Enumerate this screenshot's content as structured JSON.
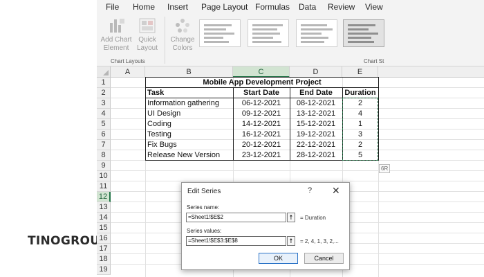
{
  "brand": {
    "name_left": "TINO",
    "name_right": "GROUP"
  },
  "menu": [
    "File",
    "Home",
    "Insert",
    "Page Layout",
    "Formulas",
    "Data",
    "Review",
    "View"
  ],
  "ribbon": {
    "add_chart_element": "Add Chart\nElement",
    "quick_layout": "Quick\nLayout",
    "change_colors": "Change\nColors",
    "group_chart_layouts": "Chart Layouts",
    "group_chart_styles": "Chart St"
  },
  "columns": [
    "A",
    "B",
    "C",
    "D",
    "E"
  ],
  "rows": [
    "1",
    "2",
    "3",
    "4",
    "5",
    "6",
    "7",
    "8",
    "9",
    "10",
    "11",
    "12",
    "13",
    "14",
    "15",
    "16",
    "17",
    "18",
    "19"
  ],
  "sheet": {
    "title": "Mobile App Development Project",
    "headers": [
      "Task",
      "Start Date",
      "End Date",
      "Duration"
    ],
    "tasks": [
      {
        "task": "Information gathering",
        "start": "06-12-2021",
        "end": "08-12-2021",
        "duration": "2"
      },
      {
        "task": "UI Design",
        "start": "09-12-2021",
        "end": "13-12-2021",
        "duration": "4"
      },
      {
        "task": "Coding",
        "start": "14-12-2021",
        "end": "15-12-2021",
        "duration": "1"
      },
      {
        "task": "Testing",
        "start": "16-12-2021",
        "end": "19-12-2021",
        "duration": "3"
      },
      {
        "task": "Fix Bugs",
        "start": "20-12-2021",
        "end": "22-12-2021",
        "duration": "2"
      },
      {
        "task": "Release New Version",
        "start": "23-12-2021",
        "end": "28-12-2021",
        "duration": "5"
      }
    ],
    "side_tag": "6R"
  },
  "dialog": {
    "title": "Edit Series",
    "help": "?",
    "close": "✕",
    "series_name_label": "Series name:",
    "series_name_value": "=Sheet1!$E$2",
    "series_name_result": "= Duration",
    "series_values_label": "Series values:",
    "series_values_value": "=Sheet1!$E$3:$E$8",
    "series_values_result": "= 2, 4, 1, 3, 2,...",
    "collapse_glyph": "⭡",
    "ok": "OK",
    "cancel": "Cancel"
  },
  "colors": {
    "excel_green": "#217346",
    "brand_green": "#19a25f"
  },
  "icons": [
    "add-chart-element-icon",
    "quick-layout-icon",
    "change-colors-icon",
    "collapse-dialog-icon"
  ]
}
